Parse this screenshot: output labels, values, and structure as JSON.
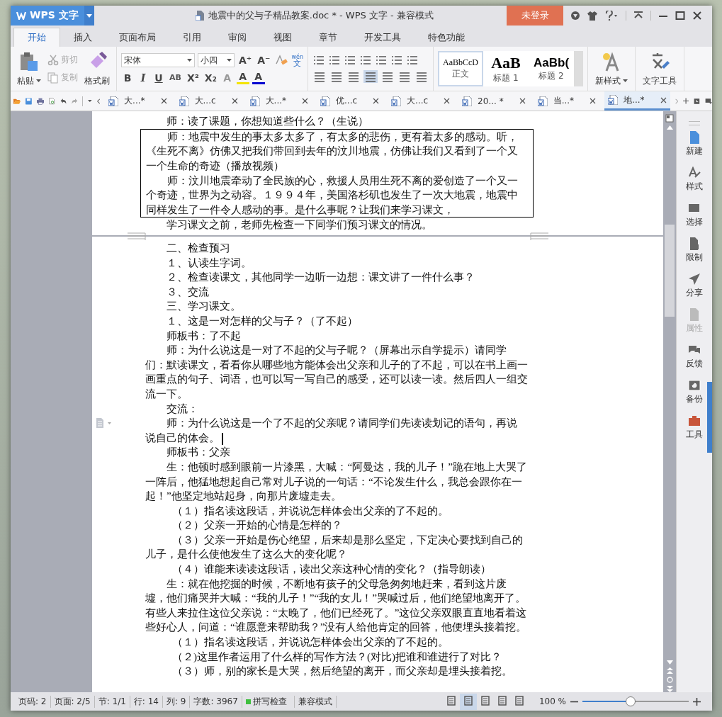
{
  "window": {
    "app_button": "WPS 文字",
    "title": "地震中的父与子精品教案.doc * - WPS 文字 - 兼容模式",
    "login_button": "未登录"
  },
  "ribbon_tabs": [
    {
      "label": "开始",
      "selected": true
    },
    {
      "label": "插入",
      "selected": false
    },
    {
      "label": "页面布局",
      "selected": false
    },
    {
      "label": "引用",
      "selected": false
    },
    {
      "label": "审阅",
      "selected": false
    },
    {
      "label": "视图",
      "selected": false
    },
    {
      "label": "章节",
      "selected": false
    },
    {
      "label": "开发工具",
      "selected": false
    },
    {
      "label": "特色功能",
      "selected": false
    }
  ],
  "clipboard": {
    "paste": "粘贴",
    "cut": {
      "label": "剪切",
      "disabled": true
    },
    "copy": {
      "label": "复制",
      "disabled": true
    },
    "format_painter": "格式刷"
  },
  "font": {
    "name": "宋体",
    "size": "小四",
    "row1": [
      "A⁺",
      "A⁻"
    ],
    "pinyin": [
      "wén",
      "文"
    ],
    "row2": [
      "B",
      "I",
      "U",
      "AB",
      "X²",
      "X₂",
      "A",
      "A",
      "A"
    ]
  },
  "styles": [
    {
      "sample": "AaBbCcD",
      "label": "正文",
      "selected": true
    },
    {
      "sample": "AaB",
      "label": "标题 1",
      "selected": false
    },
    {
      "sample": "AaBb(",
      "label": "标题 2",
      "selected": false
    }
  ],
  "new_style": "新样式",
  "text_tools": "文字工具",
  "doc_tabs": [
    {
      "label": "大...*",
      "selected": false
    },
    {
      "label": "大...c",
      "selected": false
    },
    {
      "label": "大...*",
      "selected": false
    },
    {
      "label": "优...c",
      "selected": false
    },
    {
      "label": "大...c",
      "selected": false
    },
    {
      "label": "20... *",
      "selected": false
    },
    {
      "label": "当...*",
      "selected": false
    },
    {
      "label": "地...*",
      "selected": true
    }
  ],
  "pages": [
    {
      "blocks": [
        {
          "kind": "para",
          "paragraphs": [
            {
              "text": "师：读了课题，你想知道些什么？（生说）",
              "kind": "indent"
            }
          ]
        },
        {
          "kind": "box",
          "paragraphs": [
            {
              "text": "师：地震中发生的事太多太多了，有太多的悲伤，更有着太多的感动。听，《生死不离》仿佛又把我们带回到去年的汶川地震，仿佛让我们又看到了一个又一个生命的奇迹（播放视频）",
              "kind": "indent"
            },
            {
              "text": "师：汶川地震牵动了全民族的心，救援人员用生死不离的爱创造了一个又一个奇迹，世界为之动容。１９９４年，美国洛杉矶也发生了一次大地震，地震中同样发生了一件令人感动的事。是什么事呢？让我们来学习课文，",
              "kind": "indent"
            }
          ]
        },
        {
          "kind": "para",
          "paragraphs": [
            {
              "text": "学习课文之前，老师先检查一下同学们预习课文的情况。",
              "kind": "indent"
            }
          ]
        }
      ]
    },
    {
      "blocks": [
        {
          "kind": "para",
          "paragraphs": [
            {
              "text": "二、检查预习",
              "kind": "indent"
            },
            {
              "text": "１、认读生字词。",
              "kind": "indent"
            },
            {
              "text": "２、检查读课文，其他同学一边听一边想：课文讲了一件什么事？",
              "kind": "indent"
            },
            {
              "text": "３、交流",
              "kind": "indent"
            },
            {
              "text": "三、学习课文。",
              "kind": "indent"
            },
            {
              "text": "１、这是一对怎样的父与子？（了不起）",
              "kind": "indent"
            },
            {
              "text": "师板书：了不起",
              "kind": "indent"
            },
            {
              "text": "师：为什么说这是一对了不起的父与子呢？（屏幕出示自学提示）请同学们：默读课文，看看你从哪些地方能体会出父亲和儿子的了不起，可以在书上画一画重点的句子、词语，也可以写一写自己的感受，还可以读一读。然后四人一组交流一下。",
              "kind": "indent"
            },
            {
              "text": "交流：",
              "kind": "indent"
            },
            {
              "text": "师：为什么说这是一个了不起的父亲呢？请同学们先读读划记的语句，再说说自己的体会。",
              "kind": "indent",
              "cursor": true
            },
            {
              "text": "师板书：父亲",
              "kind": "indent"
            },
            {
              "text": "生：他顿时感到眼前一片漆黑，大喊：“阿曼达，我的儿子！”跪在地上大哭了一阵后，他猛地想起自己常对儿子说的一句话：“不论发生什么，我总会跟你在一起！”他坚定地站起身，向那片废墟走去。",
              "kind": "indent"
            },
            {
              "text": "（１）指名读这段话，并说说怎样体会出父亲的了不起的。",
              "kind": "sub"
            },
            {
              "text": "（２）父亲一开始的心情是怎样的？",
              "kind": "sub"
            },
            {
              "text": "（３）父亲一开始是伤心绝望，后来却是那么坚定，下定决心要找到自己的儿子，是什么使他发生了这么大的变化呢？",
              "kind": "sub"
            },
            {
              "text": "（４）谁能来读读这段话，读出父亲这种心情的变化？（指导朗读）",
              "kind": "sub"
            },
            {
              "text": "生：就在他挖掘的时候，不断地有孩子的父母急匆匆地赶来，看到这片废墟，他们痛哭并大喊：“我的儿子！”“我的女儿！”哭喊过后，他们绝望地离开了。有些人来拉住这位父亲说：“太晚了，他们已经死了。”这位父亲双眼直直地看着这些好心人，问道：“谁愿意来帮助我？”没有人给他肯定的回答，他便埋头接着挖。",
              "kind": "indent"
            },
            {
              "text": "（１）指名读这段话，并说说怎样体会出父亲的了不起的。",
              "kind": "sub"
            },
            {
              "text": "（２)这里作者运用了什么样的写作方法？(对比)把谁和谁进行了对比？",
              "kind": "sub"
            },
            {
              "text": "（３）师，别的家长是大哭，然后绝望的离开，而父亲却是埋头接着挖。",
              "kind": "sub"
            }
          ]
        }
      ]
    }
  ],
  "sidebar": [
    {
      "label": "新建",
      "disabled": false
    },
    {
      "label": "样式",
      "disabled": false
    },
    {
      "label": "选择",
      "disabled": false
    },
    {
      "label": "限制",
      "disabled": false
    },
    {
      "label": "分享",
      "disabled": false
    },
    {
      "label": "属性",
      "disabled": true
    },
    {
      "label": "反馈",
      "disabled": false
    },
    {
      "label": "备份",
      "disabled": false
    },
    {
      "label": "工具",
      "disabled": false
    }
  ],
  "status_bar": {
    "items": [
      "页码: 2",
      "页面: 2/5",
      "节: 1/1",
      "行: 14",
      "列: 9",
      "字数: 3967"
    ],
    "spell_check": "拼写检查",
    "mode": "兼容模式",
    "views": [
      {
        "selected": false
      },
      {
        "selected": true
      },
      {
        "selected": false
      },
      {
        "selected": false
      },
      {
        "selected": false
      }
    ],
    "zoom": "100 %",
    "zoom_slider": {
      "level": 0.45
    }
  }
}
